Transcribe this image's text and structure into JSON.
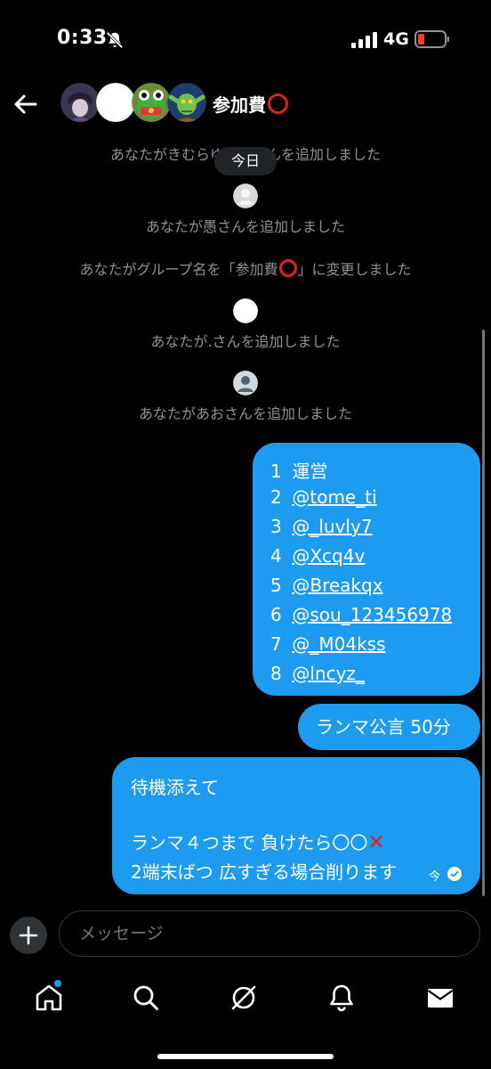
{
  "status": {
    "time": "0:33",
    "network": "4G",
    "icons": [
      "bell-slash-icon",
      "signal-icon",
      "battery-icon"
    ]
  },
  "header": {
    "title": "参加費",
    "title_emoji": "heavy-large-circle-icon",
    "avatars": [
      "avatar-anime-boy",
      "avatar-white-circle",
      "avatar-frog-character",
      "avatar-goblin"
    ]
  },
  "chat": {
    "date_pill": "今日",
    "system_messages": [
      {
        "id": "sys1",
        "text": "あなたがきむらゆ",
        "text_tail": "んを追加しました"
      },
      {
        "id": "sys2",
        "text": "あなたが愚さんを追加しました"
      },
      {
        "id": "sys3",
        "text_before": "あなたがグループ名を「参加費",
        "text_after": "」に変更しました"
      },
      {
        "id": "sys4",
        "text": "あなたが.さんを追加しました"
      },
      {
        "id": "sys5",
        "text": "あなたがあおさんを追加しました"
      }
    ],
    "bubble1": {
      "lines": [
        {
          "num": "1",
          "text": "運営"
        },
        {
          "num": "2",
          "handle": "@tome_ti"
        },
        {
          "num": "3",
          "handle": "@_luvly7"
        },
        {
          "num": "4",
          "handle": "@Xcq4v"
        },
        {
          "num": "5",
          "handle": "@Breakqx"
        },
        {
          "num": "6",
          "handle": "@sou_123456978"
        },
        {
          "num": "7",
          "handle": "@_M04kss"
        },
        {
          "num": "8",
          "handle": "@lncyz_"
        }
      ]
    },
    "bubble2": {
      "text": "ランマ公言 50分"
    },
    "bubble3": {
      "line1": "待機添えて",
      "line2": "ランマ４つまで 負けたら〇〇",
      "line3": "2端末ばつ 広すぎる場合削ります",
      "timestamp": "今"
    }
  },
  "composer": {
    "placeholder": "メッセージ"
  },
  "tabs": [
    "home-icon",
    "search-icon",
    "grok-icon",
    "notifications-icon",
    "messages-icon"
  ],
  "colors": {
    "accent": "#1d9bf0",
    "background": "#000000",
    "muted_text": "#8b9198",
    "red": "#e0221b"
  }
}
